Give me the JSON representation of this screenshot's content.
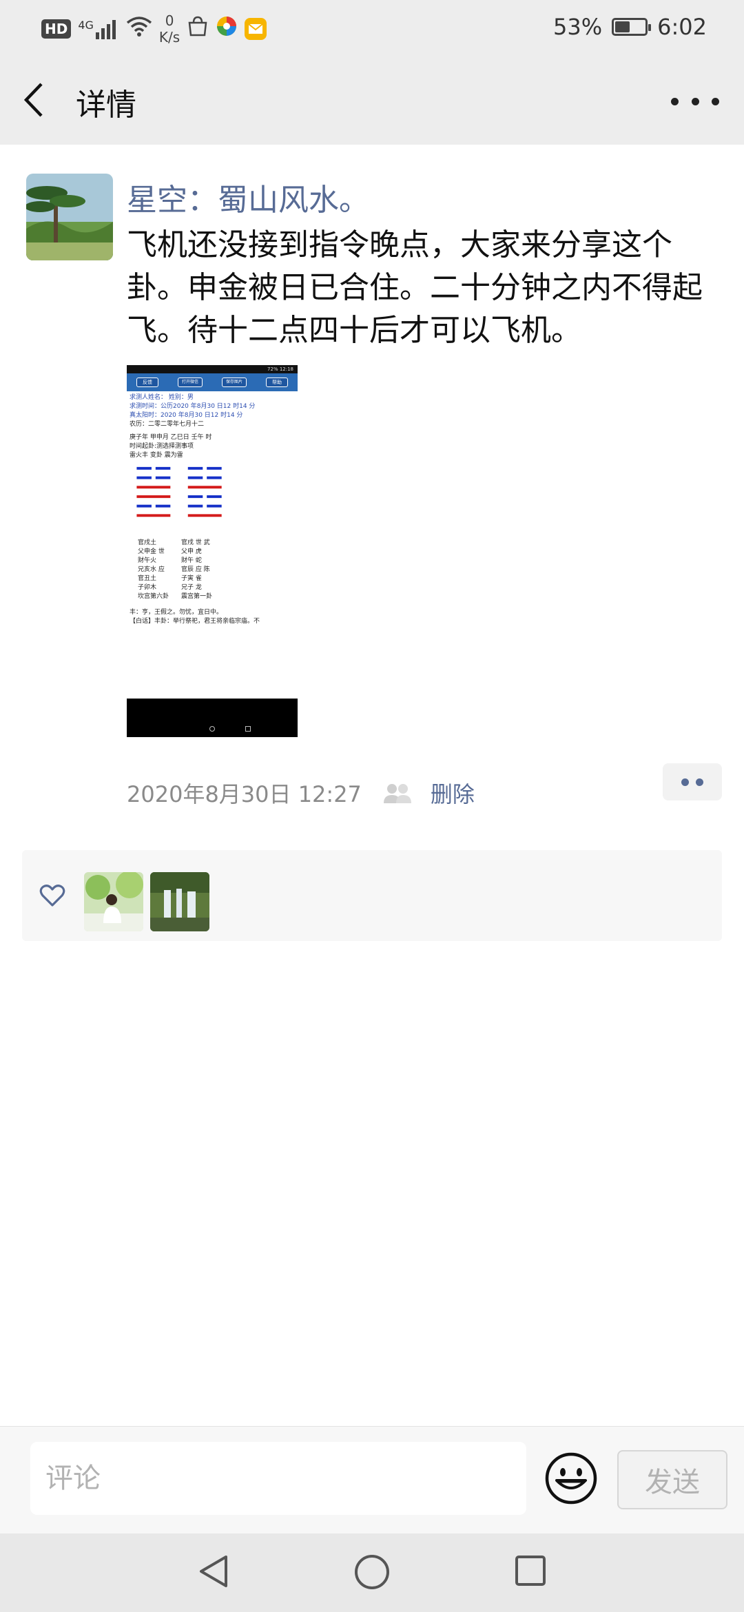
{
  "status_bar": {
    "network_badge": "HD",
    "network_type": "4G",
    "speed_value": "0",
    "speed_unit": "K/s",
    "battery_percent": "53%",
    "battery_level": 0.53,
    "time": "6:02"
  },
  "nav": {
    "title": "详情",
    "back_icon": "chevron-left-icon",
    "more_icon": "more-dots-icon"
  },
  "post": {
    "author": "星空：蜀山风水。",
    "text": "飞机还没接到指令晚点，大家来分享这个卦。申金被日已合住。二十分钟之内不得起飞。待十二点四十后才可以飞机。",
    "image": {
      "status": "72%  12:18",
      "toolbar": [
        "反馈",
        "打开微信",
        "保存图片",
        "帮助"
      ],
      "lines": [
        "求测人姓名：     姓别：男",
        "求测时间：公历2020 年8月30 日12 时14 分",
        "真太阳时：2020 年8月30 日12 时14 分",
        "农历：二零二零年七月十二",
        "庚子年 甲申月 乙巳日 壬午 时",
        "时间起卦:测选择测事项",
        "    雷火丰      变卦 震为雷"
      ],
      "left_rows": [
        "官戌土",
        "父申金 世",
        "财午火",
        "兄亥水 应",
        "官丑土",
        "子卯木",
        "坎宫第六卦"
      ],
      "right_rows": [
        "官戌 世 武",
        "父申   虎",
        "财午   蛇",
        "官辰 应 陈",
        "子寅   雀",
        "兄子   龙",
        "震宫第一卦"
      ],
      "footer_lines": [
        "丰：亨，王假之。勿忧，宜日中。",
        "【白话】丰卦：举行祭祀，君王将亲临宗庙。不"
      ]
    },
    "timestamp": "2020年8月30日 12:27",
    "delete_label": "删除"
  },
  "likes": {
    "heart_icon": "heart-outline-icon",
    "count": 2
  },
  "comment": {
    "placeholder": "评论",
    "send_label": "发送",
    "emoji_icon": "smiley-icon"
  },
  "system_nav": {
    "back": "triangle-back-icon",
    "home": "circle-home-icon",
    "recents": "square-recents-icon"
  }
}
